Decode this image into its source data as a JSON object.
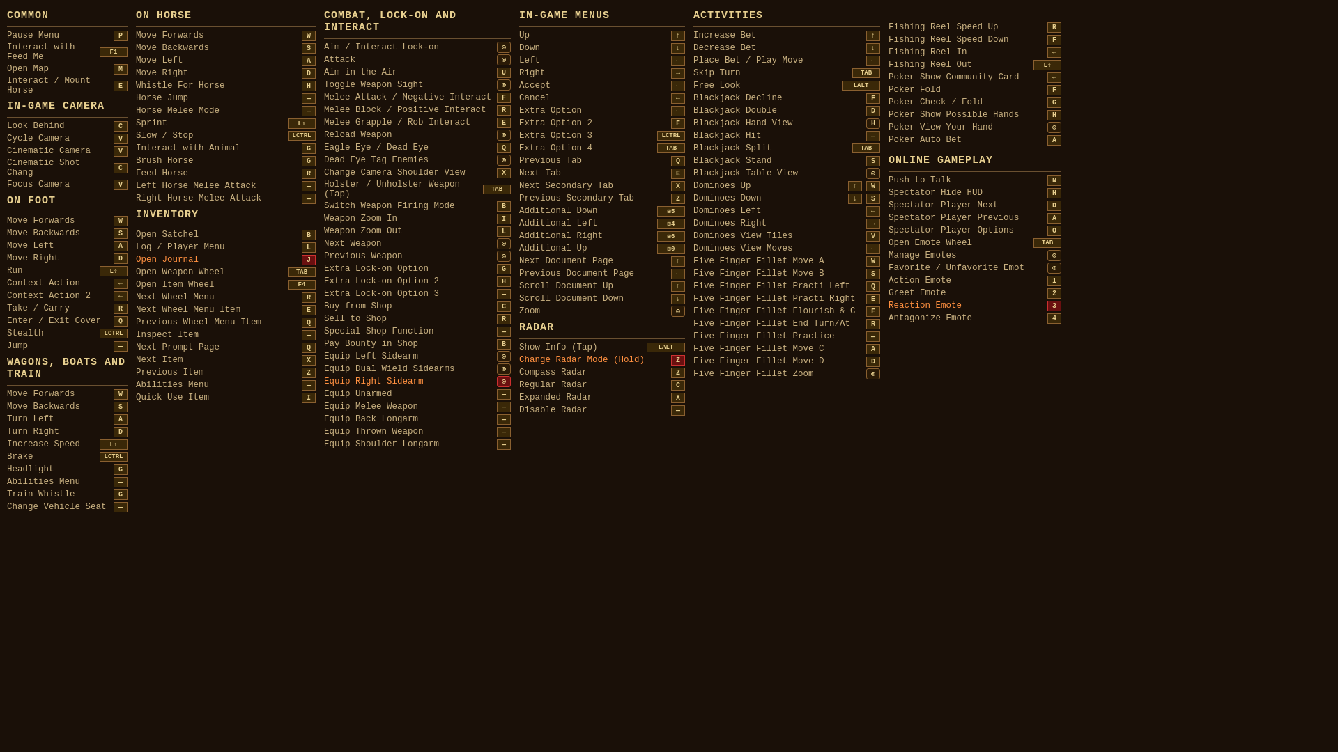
{
  "sections": {
    "common": {
      "header": "Common",
      "items": [
        {
          "label": "Pause Menu",
          "key": "P"
        },
        {
          "label": "Interact with Feed Me",
          "key": "F1"
        },
        {
          "label": "Open Map",
          "key": "M"
        },
        {
          "label": "Interact / Mount Horse",
          "key": "E"
        }
      ]
    },
    "inGameCamera": {
      "header": "In-Game Camera",
      "items": [
        {
          "label": "Look Behind",
          "key": "C"
        },
        {
          "label": "Cycle Camera",
          "key": "V"
        },
        {
          "label": "Cinematic Camera",
          "key": "V"
        },
        {
          "label": "Cinematic Shot Chang",
          "key": "C"
        },
        {
          "label": "Focus Camera",
          "key": "V"
        }
      ]
    },
    "onFoot": {
      "header": "On Foot",
      "items": [
        {
          "label": "Move Forwards",
          "key": "W"
        },
        {
          "label": "Move Backwards",
          "key": "S"
        },
        {
          "label": "Move Left",
          "key": "A"
        },
        {
          "label": "Move Right",
          "key": "D"
        },
        {
          "label": "Run",
          "key": "L⇧"
        },
        {
          "label": "Context Action",
          "key": "←"
        },
        {
          "label": "Context Action 2",
          "key": "←"
        },
        {
          "label": "Take / Carry",
          "key": "R"
        },
        {
          "label": "Enter / Exit Cover",
          "key": "Q"
        },
        {
          "label": "Stealth",
          "key": "LCTRL"
        },
        {
          "label": "Jump",
          "key": "—"
        }
      ]
    },
    "wagons": {
      "header": "Wagons, Boats and Train",
      "items": [
        {
          "label": "Move Forwards",
          "key": "W"
        },
        {
          "label": "Move Backwards",
          "key": "S"
        },
        {
          "label": "Turn Left",
          "key": "A"
        },
        {
          "label": "Turn Right",
          "key": "D"
        },
        {
          "label": "Increase Speed",
          "key": "L⇧"
        },
        {
          "label": "Brake",
          "key": "LCTRL"
        },
        {
          "label": "Headlight",
          "key": "G"
        },
        {
          "label": "Abilities Menu",
          "key": "—"
        },
        {
          "label": "Train Whistle",
          "key": "G"
        },
        {
          "label": "Change Vehicle Seat",
          "key": "—"
        }
      ]
    },
    "onHorse": {
      "header": "On Horse",
      "items": [
        {
          "label": "Move Forwards",
          "key": "W"
        },
        {
          "label": "Move Backwards",
          "key": "S"
        },
        {
          "label": "Move Left",
          "key": "A"
        },
        {
          "label": "Move Right",
          "key": "D"
        },
        {
          "label": "Whistle For Horse",
          "key": "H"
        },
        {
          "label": "Horse Jump",
          "key": "—"
        },
        {
          "label": "Horse Melee Mode",
          "key": "—"
        },
        {
          "label": "Sprint",
          "key": "L⇧"
        },
        {
          "label": "Slow / Stop",
          "key": "LCTRL"
        },
        {
          "label": "Interact with Animal",
          "key": "G"
        },
        {
          "label": "Brush Horse",
          "key": "G"
        },
        {
          "label": "Feed Horse",
          "key": "R"
        },
        {
          "label": "Left Horse Melee Attack",
          "key": "—"
        },
        {
          "label": "Right Horse Melee Attack",
          "key": "—"
        }
      ]
    },
    "inventory": {
      "header": "Inventory",
      "items": [
        {
          "label": "Open Satchel",
          "key": "B"
        },
        {
          "label": "Log / Player Menu",
          "key": "L"
        },
        {
          "label": "Open Journal",
          "key": "J",
          "highlight": true
        },
        {
          "label": "Open Weapon Wheel",
          "key": "TAB"
        },
        {
          "label": "Open Item Wheel",
          "key": "F4"
        },
        {
          "label": "Next Wheel Menu",
          "key": "R"
        },
        {
          "label": "Next Wheel Menu Item",
          "key": "E"
        },
        {
          "label": "Previous Wheel Menu Item",
          "key": "Q"
        },
        {
          "label": "Inspect Item",
          "key": "—"
        },
        {
          "label": "Next Prompt Page",
          "key": "Q"
        },
        {
          "label": "Next Item",
          "key": "X"
        },
        {
          "label": "Previous Item",
          "key": "Z"
        },
        {
          "label": "Abilities Menu",
          "key": "—"
        },
        {
          "label": "Quick Use Item",
          "key": "I"
        }
      ]
    },
    "combat": {
      "header": "Combat, Lock-On and Interact",
      "items": [
        {
          "label": "Aim / Interact Lock-on",
          "key": "🎮"
        },
        {
          "label": "Attack",
          "key": "🎮"
        },
        {
          "label": "Aim in the Air",
          "key": "U"
        },
        {
          "label": "Toggle Weapon Sight",
          "key": "🎮"
        },
        {
          "label": "Melee Attack / Negative Interact",
          "key": "F"
        },
        {
          "label": "Melee Block / Positive Interact",
          "key": "R"
        },
        {
          "label": "Melee Grapple / Rob Interact",
          "key": "E"
        },
        {
          "label": "Reload Weapon",
          "key": "🎮"
        },
        {
          "label": "Eagle Eye / Dead Eye",
          "key": "Q"
        },
        {
          "label": "Dead Eye Tag Enemies",
          "key": "🎮"
        },
        {
          "label": "Change Camera Shoulder View",
          "key": "X"
        },
        {
          "label": "Holster / Unholster Weapon (Tap)",
          "key": "TAB"
        },
        {
          "label": "Switch Weapon Firing Mode",
          "key": "B"
        },
        {
          "label": "Weapon Zoom In",
          "key": "I"
        },
        {
          "label": "Weapon Zoom Out",
          "key": "L"
        },
        {
          "label": "Next Weapon",
          "key": "🎮"
        },
        {
          "label": "Previous Weapon",
          "key": "🎮"
        },
        {
          "label": "Extra Lock-on Option",
          "key": "G"
        },
        {
          "label": "Extra Lock-on Option 2",
          "key": "H"
        },
        {
          "label": "Extra Lock-on Option 3",
          "key": "—"
        },
        {
          "label": "Buy from Shop",
          "key": "C"
        },
        {
          "label": "Sell to Shop",
          "key": "R"
        },
        {
          "label": "Special Shop Function",
          "key": "—"
        },
        {
          "label": "Pay Bounty in Shop",
          "key": "B"
        },
        {
          "label": "Equip Left Sidearm",
          "key": "🎮"
        },
        {
          "label": "Equip Dual Wield Sidearms",
          "key": "🎮"
        },
        {
          "label": "Equip Right Sidearm",
          "key": "🎮",
          "highlight": true
        },
        {
          "label": "Equip Unarmed",
          "key": "—"
        },
        {
          "label": "Equip Melee Weapon",
          "key": "—"
        },
        {
          "label": "Equip Back Longarm",
          "key": "—"
        },
        {
          "label": "Equip Thrown Weapon",
          "key": "—"
        },
        {
          "label": "Equip Shoulder Longarm",
          "key": "—"
        }
      ]
    },
    "inGameMenus": {
      "header": "In-Game Menus",
      "items": [
        {
          "label": "Up",
          "key": "↑"
        },
        {
          "label": "Down",
          "key": "↓"
        },
        {
          "label": "Left",
          "key": "←"
        },
        {
          "label": "Right",
          "key": "→"
        },
        {
          "label": "Accept",
          "key": "←"
        },
        {
          "label": "Cancel",
          "key": "←"
        },
        {
          "label": "Extra Option",
          "key": "←"
        },
        {
          "label": "Extra Option 2",
          "key": "F"
        },
        {
          "label": "Extra Option 3",
          "key": "LCTRL"
        },
        {
          "label": "Extra Option 4",
          "key": "TAB"
        },
        {
          "label": "Previous Tab",
          "key": "Q"
        },
        {
          "label": "Next Tab",
          "key": "E"
        },
        {
          "label": "Next Secondary Tab",
          "key": "X"
        },
        {
          "label": "Previous Secondary Tab",
          "key": "Z"
        },
        {
          "label": "Additional Down",
          "key": "⊞5"
        },
        {
          "label": "Additional Left",
          "key": "⊞4"
        },
        {
          "label": "Additional Right",
          "key": "⊞6"
        },
        {
          "label": "Additional Up",
          "key": "⊞0"
        },
        {
          "label": "Next Document Page",
          "key": "↑"
        },
        {
          "label": "Previous Document Page",
          "key": "←"
        },
        {
          "label": "Scroll Document Up",
          "key": "↑"
        },
        {
          "label": "Scroll Document Down",
          "key": "↓"
        },
        {
          "label": "Zoom",
          "key": "🎮"
        }
      ]
    },
    "radar": {
      "header": "Radar",
      "items": [
        {
          "label": "Show Info (Tap)",
          "key": "LALT"
        },
        {
          "label": "Change Radar Mode (Hold)",
          "key": "Z",
          "highlight": true
        },
        {
          "label": "Compass Radar",
          "key": "Z"
        },
        {
          "label": "Regular Radar",
          "key": "C"
        },
        {
          "label": "Expanded Radar",
          "key": "X"
        },
        {
          "label": "Disable Radar",
          "key": "—"
        }
      ]
    },
    "activities": {
      "header": "Activities",
      "items": [
        {
          "label": "Increase Bet",
          "key": "↑"
        },
        {
          "label": "Decrease Bet",
          "key": "↓"
        },
        {
          "label": "Place Bet / Play Move",
          "key": "←"
        },
        {
          "label": "Skip Turn",
          "key": "TAB"
        },
        {
          "label": "Free Look",
          "key": "LALT"
        },
        {
          "label": "Blackjack Decline",
          "key": "F"
        },
        {
          "label": "Blackjack Double",
          "key": "D"
        },
        {
          "label": "Blackjack Hand View",
          "key": "H"
        },
        {
          "label": "Blackjack Hit",
          "key": "—"
        },
        {
          "label": "Blackjack Split",
          "key": "TAB"
        },
        {
          "label": "Blackjack Stand",
          "key": "S"
        },
        {
          "label": "Blackjack Table View",
          "key": "🎮"
        },
        {
          "label": "Dominoes Up",
          "key": "↑W"
        },
        {
          "label": "Dominoes Down",
          "key": "↓S"
        },
        {
          "label": "Dominoes Left",
          "key": "←"
        },
        {
          "label": "Dominoes Right",
          "key": "→"
        },
        {
          "label": "Dominoes View Tiles",
          "key": "V"
        },
        {
          "label": "Dominoes View Moves",
          "key": "←"
        },
        {
          "label": "Five Finger Fillet Move A",
          "key": "W"
        },
        {
          "label": "Five Finger Fillet Move B",
          "key": "S"
        },
        {
          "label": "Five Finger Fillet Practi Left",
          "key": "Q"
        },
        {
          "label": "Five Finger Fillet Practi Right",
          "key": "E"
        },
        {
          "label": "Five Finger Fillet Flourish & C",
          "key": "F"
        },
        {
          "label": "Five Finger Fillet End Turn/At",
          "key": "R"
        },
        {
          "label": "Five Finger Fillet Practice",
          "key": "—"
        },
        {
          "label": "Five Finger Fillet Move C",
          "key": "A"
        },
        {
          "label": "Five Finger Fillet Move D",
          "key": "D"
        },
        {
          "label": "Five Finger Fillet Zoom",
          "key": "🎮"
        }
      ]
    },
    "fishingActivities": {
      "items": [
        {
          "label": "Fishing Reel Speed Up",
          "key": "R"
        },
        {
          "label": "Fishing Reel Speed Down",
          "key": "F"
        },
        {
          "label": "Fishing Reel In",
          "key": "←"
        },
        {
          "label": "Fishing Reel Out",
          "key": "L⇧"
        },
        {
          "label": "Poker Show Community Card",
          "key": "←"
        },
        {
          "label": "Poker Fold",
          "key": "F"
        },
        {
          "label": "Poker Check / Fold",
          "key": "G"
        },
        {
          "label": "Poker Show Possible Hands",
          "key": "H"
        },
        {
          "label": "Poker View Your Hand",
          "key": "🎮"
        },
        {
          "label": "Poker Auto Bet",
          "key": "A"
        }
      ]
    },
    "onlineGameplay": {
      "header": "Online Gameplay",
      "items": [
        {
          "label": "Push to Talk",
          "key": "N"
        },
        {
          "label": "Spectator Hide HUD",
          "key": "H"
        },
        {
          "label": "Spectator Player Next",
          "key": "D"
        },
        {
          "label": "Spectator Player Previous",
          "key": "A"
        },
        {
          "label": "Spectator Player Options",
          "key": "O"
        },
        {
          "label": "Open Emote Wheel",
          "key": "TAB"
        },
        {
          "label": "Manage Emotes",
          "key": "🎮"
        },
        {
          "label": "Favorite / Unfavorite Emot",
          "key": "🎮"
        },
        {
          "label": "Action Emote",
          "key": "1"
        },
        {
          "label": "Greet Emote",
          "key": "2"
        },
        {
          "label": "Reaction Emote",
          "key": "3",
          "highlight": true
        },
        {
          "label": "Antagonize Emote",
          "key": "4"
        }
      ]
    }
  }
}
